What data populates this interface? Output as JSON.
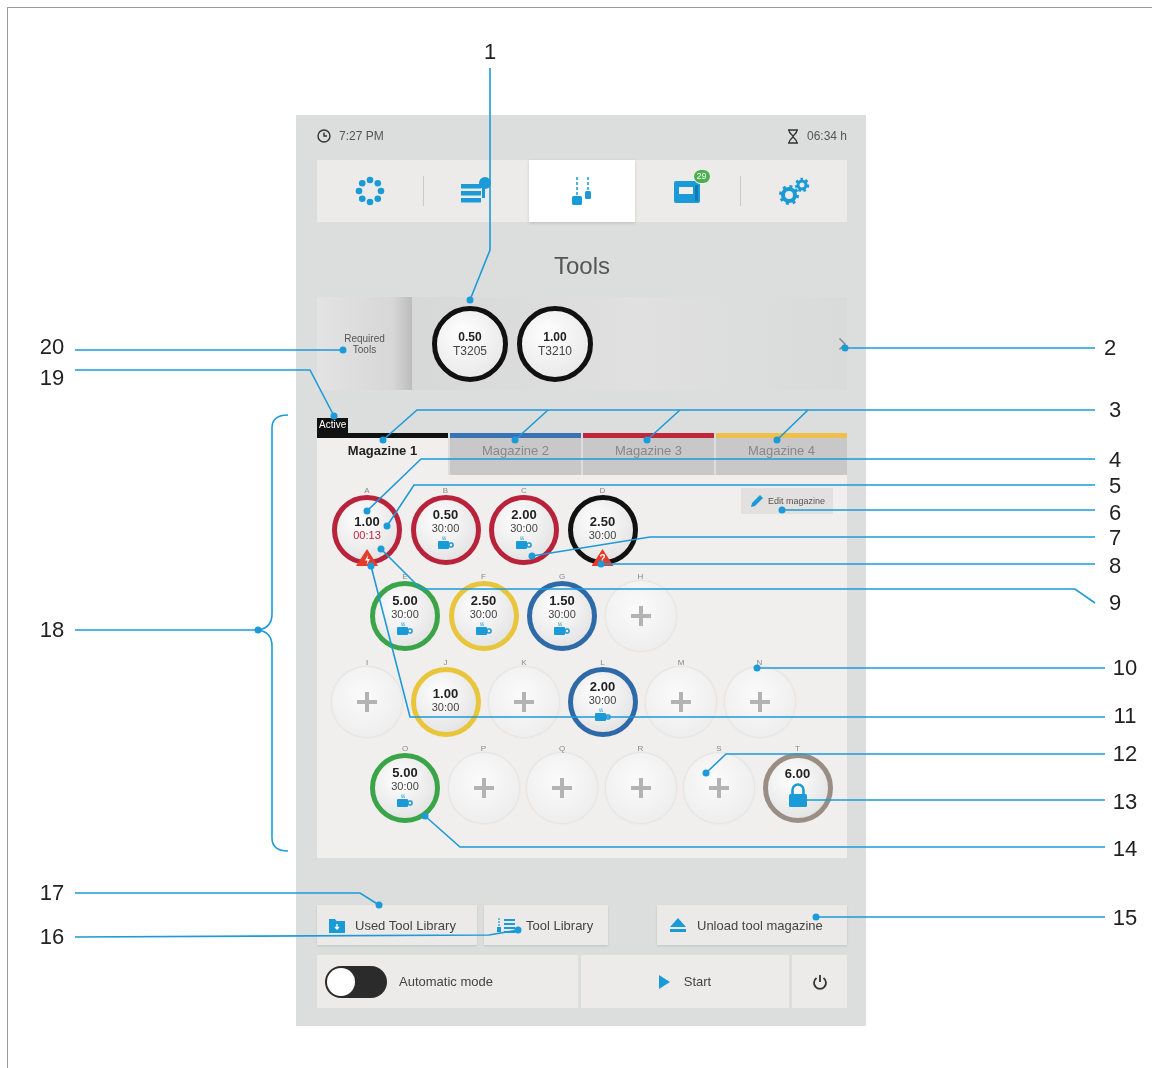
{
  "status_bar": {
    "time": "7:27 PM",
    "remaining": "06:34 h"
  },
  "nav_tabs": [
    {
      "kind": "overview",
      "selected": false
    },
    {
      "kind": "jobs",
      "selected": false
    },
    {
      "kind": "tools",
      "selected": true
    },
    {
      "kind": "machine",
      "selected": false,
      "badge": "29"
    },
    {
      "kind": "settings",
      "selected": false
    }
  ],
  "title": "Tools",
  "required_tools": {
    "label": "Required Tools",
    "tools": [
      {
        "diameter": "0.50",
        "number": "T3205"
      },
      {
        "diameter": "1.00",
        "number": "T3210"
      }
    ]
  },
  "active_label": "Active",
  "magazine_tabs": [
    {
      "label": "Magazine 1",
      "color": "#111111",
      "selected": true
    },
    {
      "label": "Magazine 2",
      "color": "#3a73b5",
      "selected": false
    },
    {
      "label": "Magazine 3",
      "color": "#c0253a",
      "selected": false
    },
    {
      "label": "Magazine 4",
      "color": "#eebf4a",
      "selected": false
    }
  ],
  "edit_button": "Edit magazine",
  "slot_rows": [
    [
      {
        "letter": "A",
        "kind": "tool",
        "value": "1.00",
        "time": "00:13",
        "time_alert": true,
        "color": "#b8223a",
        "coolant": false,
        "warning": {
          "kind": "lightning"
        }
      },
      {
        "letter": "B",
        "kind": "tool",
        "value": "0.50",
        "time": "30:00",
        "time_alert": false,
        "color": "#b8223a",
        "coolant": true
      },
      {
        "letter": "C",
        "kind": "tool",
        "value": "2.00",
        "time": "30:00",
        "time_alert": false,
        "color": "#b8223a",
        "coolant": true
      },
      {
        "letter": "D",
        "kind": "tool",
        "value": "2.50",
        "time": "30:00",
        "time_alert": false,
        "color": "#111111",
        "coolant": false,
        "warning": {
          "kind": "text",
          "symbol": "?"
        }
      }
    ],
    [
      {
        "letter": "E",
        "kind": "tool",
        "value": "5.00",
        "time": "30:00",
        "time_alert": false,
        "color": "#3aa548",
        "coolant": true
      },
      {
        "letter": "F",
        "kind": "tool",
        "value": "2.50",
        "time": "30:00",
        "time_alert": false,
        "color": "#e8c53a",
        "coolant": true
      },
      {
        "letter": "G",
        "kind": "tool",
        "value": "1.50",
        "time": "30:00",
        "time_alert": false,
        "color": "#2f6aa8",
        "coolant": true
      },
      {
        "letter": "H",
        "kind": "empty"
      }
    ],
    [
      {
        "letter": "I",
        "kind": "empty"
      },
      {
        "letter": "J",
        "kind": "tool",
        "value": "1.00",
        "time": "30:00",
        "time_alert": false,
        "color": "#e8c53a",
        "coolant": false
      },
      {
        "letter": "K",
        "kind": "empty"
      },
      {
        "letter": "L",
        "kind": "tool",
        "value": "2.00",
        "time": "30:00",
        "time_alert": false,
        "color": "#2f6aa8",
        "coolant": true
      },
      {
        "letter": "M",
        "kind": "empty"
      },
      {
        "letter": "N",
        "kind": "empty"
      }
    ],
    [
      {
        "letter": "O",
        "kind": "tool",
        "value": "5.00",
        "time": "30:00",
        "time_alert": false,
        "color": "#3aa548",
        "coolant": true
      },
      {
        "letter": "P",
        "kind": "empty"
      },
      {
        "letter": "Q",
        "kind": "empty"
      },
      {
        "letter": "R",
        "kind": "empty"
      },
      {
        "letter": "S",
        "kind": "empty"
      },
      {
        "letter": "T",
        "kind": "locked",
        "value": "6.00",
        "color": "#9a8e84"
      }
    ]
  ],
  "buttons": [
    {
      "kind": "used-library",
      "label": "Used Tool Library"
    },
    {
      "kind": "library",
      "label": "Tool Library"
    },
    {
      "kind": "unload",
      "label": "Unload tool magazine"
    }
  ],
  "footer": {
    "automatic_mode": {
      "label": "Automatic mode",
      "on": false
    },
    "start": "Start"
  },
  "callouts": [
    {
      "number": "1"
    },
    {
      "number": "20"
    },
    {
      "number": "2"
    },
    {
      "number": "19"
    },
    {
      "number": "3"
    },
    {
      "number": "4"
    },
    {
      "number": "5"
    },
    {
      "number": "6"
    },
    {
      "number": "7"
    },
    {
      "number": "8"
    },
    {
      "number": "9"
    },
    {
      "number": "18"
    },
    {
      "number": "10"
    },
    {
      "number": "11"
    },
    {
      "number": "12"
    },
    {
      "number": "13"
    },
    {
      "number": "14"
    },
    {
      "number": "17"
    },
    {
      "number": "15"
    },
    {
      "number": "16"
    }
  ]
}
